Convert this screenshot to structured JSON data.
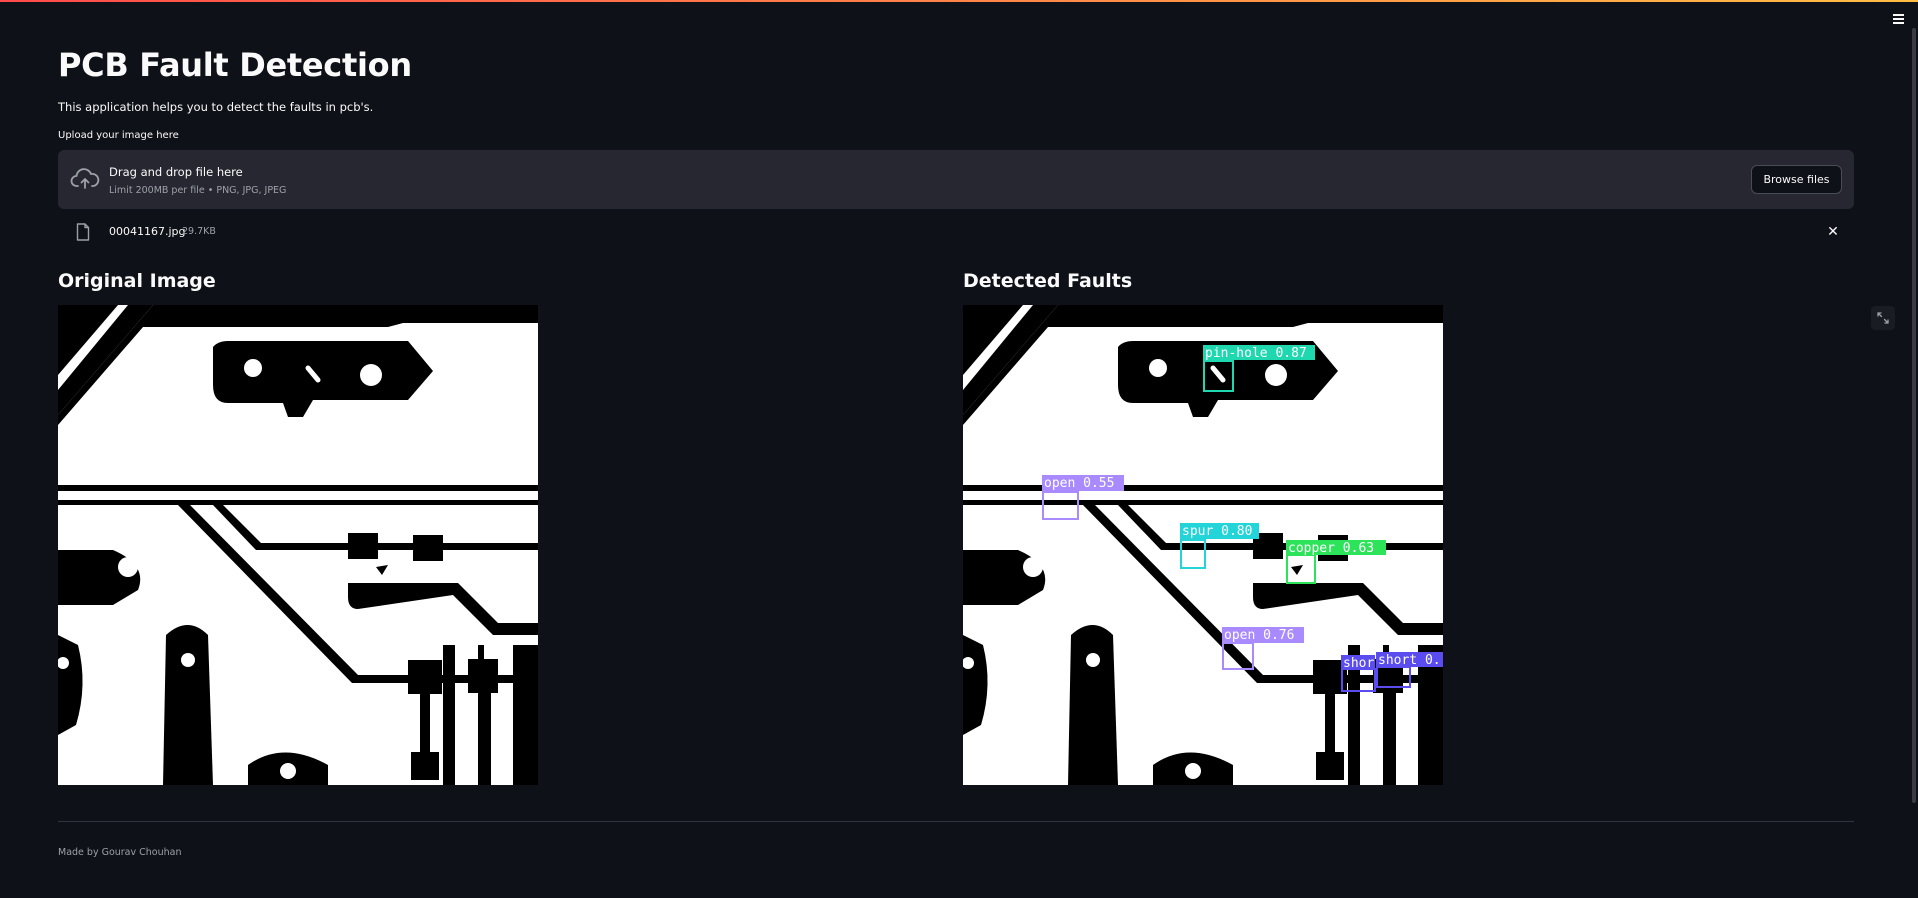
{
  "app": {
    "title": "PCB Fault Detection",
    "subtitle": "This application helps you to detect the faults in pcb's."
  },
  "uploader": {
    "label": "Upload your image here",
    "dropzone_title": "Drag and drop file here",
    "dropzone_limit": "Limit 200MB per file • PNG, JPG, JPEG",
    "browse_label": "Browse files",
    "icon": "cloud-upload-icon"
  },
  "uploaded_file": {
    "name": "00041167.jpg",
    "size": "29.7KB",
    "icon": "file-icon",
    "remove_icon": "close-icon"
  },
  "columns": {
    "original_title": "Original Image",
    "detected_title": "Detected Faults"
  },
  "detections": [
    {
      "label": "pin-hole 0.87",
      "color": "#1fd8b0"
    },
    {
      "label": "open 0.55",
      "color": "#a98bff"
    },
    {
      "label": "spur 0.80",
      "color": "#23d5d8"
    },
    {
      "label": "copper 0.63",
      "color": "#2ce35a"
    },
    {
      "label": "open 0.76",
      "color": "#a98bff"
    },
    {
      "label": "shor",
      "color": "#5b4cf0"
    },
    {
      "label": "short 0.",
      "color": "#5b4cf0"
    }
  ],
  "footer": {
    "credit": "Made by Gourav Chouhan"
  },
  "colors": {
    "background": "#0e1117",
    "panel": "#262730",
    "accent_gradient_start": "#ff4b4b",
    "accent_gradient_end": "#ffbd45"
  }
}
